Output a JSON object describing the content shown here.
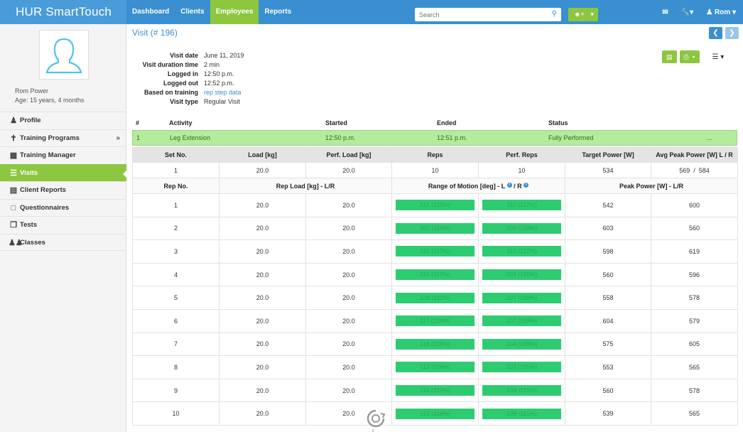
{
  "brand": {
    "prefix": "HUR",
    "name": "SmartTouch"
  },
  "nav": [
    {
      "label": "Dashboard",
      "active": false
    },
    {
      "label": "Clients",
      "active": false
    },
    {
      "label": "Employees",
      "active": true
    },
    {
      "label": "Reports",
      "active": false
    }
  ],
  "search": {
    "placeholder": "Search"
  },
  "user": {
    "name": "Rom"
  },
  "patient": {
    "name": "Rom Power",
    "age": "Age: 15 years, 4 months"
  },
  "sidebar": {
    "items": [
      {
        "label": "Profile",
        "icon": "user-icon"
      },
      {
        "label": "Training Programs",
        "icon": "training-icon"
      },
      {
        "label": "Training Manager",
        "icon": "calendar-icon"
      },
      {
        "label": "Visits",
        "icon": "list-icon"
      },
      {
        "label": "Client Reports",
        "icon": "chart-icon"
      },
      {
        "label": "Questionnaires",
        "icon": "document-icon"
      },
      {
        "label": "Tests",
        "icon": "copy-icon"
      },
      {
        "label": "Classes",
        "icon": "group-icon"
      }
    ]
  },
  "visit": {
    "title": "Visit (# 196)",
    "meta": [
      {
        "key": "Visit date",
        "value": "June 11, 2019"
      },
      {
        "key": "Visit duration time",
        "value": "2 min"
      },
      {
        "key": "Logged in",
        "value": "12:50 p.m."
      },
      {
        "key": "Logged out",
        "value": "12:52 p.m."
      },
      {
        "key": "Based on training",
        "value": "rep step data"
      },
      {
        "key": "Visit type",
        "value": "Regular Visit"
      }
    ]
  },
  "activity": {
    "headers": {
      "num": "#",
      "activity": "Activity",
      "started": "Started",
      "ended": "Ended",
      "status": "Status"
    },
    "row": {
      "num": "1",
      "activity": "Leg Extension",
      "started": "12:50 p.m.",
      "ended": "12:51 p.m.",
      "status": "Fully Performed",
      "more": "..."
    }
  },
  "set_table": {
    "headers": [
      "Set No.",
      "Load [kg]",
      "Perf. Load [kg]",
      "Reps",
      "Perf. Reps",
      "Target Power [W]",
      "Avg Peak Power [W] L / R"
    ],
    "row": [
      "1",
      "20.0",
      "20.0",
      "10",
      "10",
      "534",
      "569  /  584"
    ]
  },
  "rep_table": {
    "headers": {
      "rep_no": "Rep No.",
      "rep_load": "Rep Load [kg] - L/R",
      "rom": "Range of Motion [deg] - L",
      "rom_sep": " / R",
      "peak": "Peak Power [W] - L/R"
    },
    "rows": [
      {
        "rep": "1",
        "load_l": "20.0",
        "load_r": "20.0",
        "rom_l": "112 (115%)",
        "rom_r": "110 (112%)",
        "peak_l": "542",
        "peak_r": "600"
      },
      {
        "rep": "2",
        "load_l": "20.0",
        "load_r": "20.0",
        "rom_l": "107 (110%)",
        "rom_r": "106 (108%)",
        "peak_l": "603",
        "peak_r": "560"
      },
      {
        "rep": "3",
        "load_l": "20.0",
        "load_r": "20.0",
        "rom_l": "110 (113%)",
        "rom_r": "110 (112%)",
        "peak_l": "598",
        "peak_r": "619"
      },
      {
        "rep": "4",
        "load_l": "20.0",
        "load_r": "20.0",
        "rom_l": "110 (113%)",
        "rom_r": "103 (105%)",
        "peak_l": "560",
        "peak_r": "596"
      },
      {
        "rep": "5",
        "load_l": "20.0",
        "load_r": "20.0",
        "rom_l": "108 (111%)",
        "rom_r": "107 (109%)",
        "peak_l": "558",
        "peak_r": "578"
      },
      {
        "rep": "6",
        "load_l": "20.0",
        "load_r": "20.0",
        "rom_l": "117 (120%)",
        "rom_r": "107 (109%)",
        "peak_l": "604",
        "peak_r": "579"
      },
      {
        "rep": "7",
        "load_l": "20.0",
        "load_r": "20.0",
        "rom_l": "116 (119%)",
        "rom_r": "104 (106%)",
        "peak_l": "575",
        "peak_r": "605"
      },
      {
        "rep": "8",
        "load_l": "20.0",
        "load_r": "20.0",
        "rom_l": "113 (116%)",
        "rom_r": "103 (105%)",
        "peak_l": "553",
        "peak_r": "565"
      },
      {
        "rep": "9",
        "load_l": "20.0",
        "load_r": "20.0",
        "rom_l": "110 (113%)",
        "rom_r": "109 (111%)",
        "peak_l": "560",
        "peak_r": "578"
      },
      {
        "rep": "10",
        "load_l": "20.0",
        "load_r": "20.0",
        "rom_l": "113 (116%)",
        "rom_r": "109 (111%)",
        "peak_l": "539",
        "peak_r": "565"
      }
    ]
  },
  "colors": {
    "primary": "#3a8fd0",
    "accent": "#8dc63f",
    "rom_bar": "#2ecc71",
    "activity_row": "#b4eb9c"
  }
}
